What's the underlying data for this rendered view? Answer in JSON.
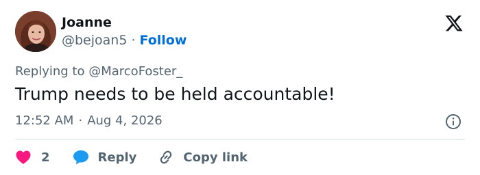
{
  "author": {
    "name": "Joanne",
    "handle": "@bejoan5",
    "separator": "·",
    "follow_label": "Follow"
  },
  "header": {
    "logo_icon": "x-logo-icon"
  },
  "tweet": {
    "replying_prefix": "Replying to",
    "replying_to": "@MarcoFoster_",
    "text": "Trump needs to be held accountable!",
    "time": "12:52 AM",
    "separator": "·",
    "date": "Aug 4, 2026"
  },
  "actions": {
    "like_count": "2",
    "reply_label": "Reply",
    "copy_link_label": "Copy link"
  },
  "colors": {
    "accent": "#006fd6",
    "like": "#f91880",
    "reply_bubble": "#1d9bf0",
    "muted_text": "#536471",
    "divider": "#cfd9de"
  }
}
